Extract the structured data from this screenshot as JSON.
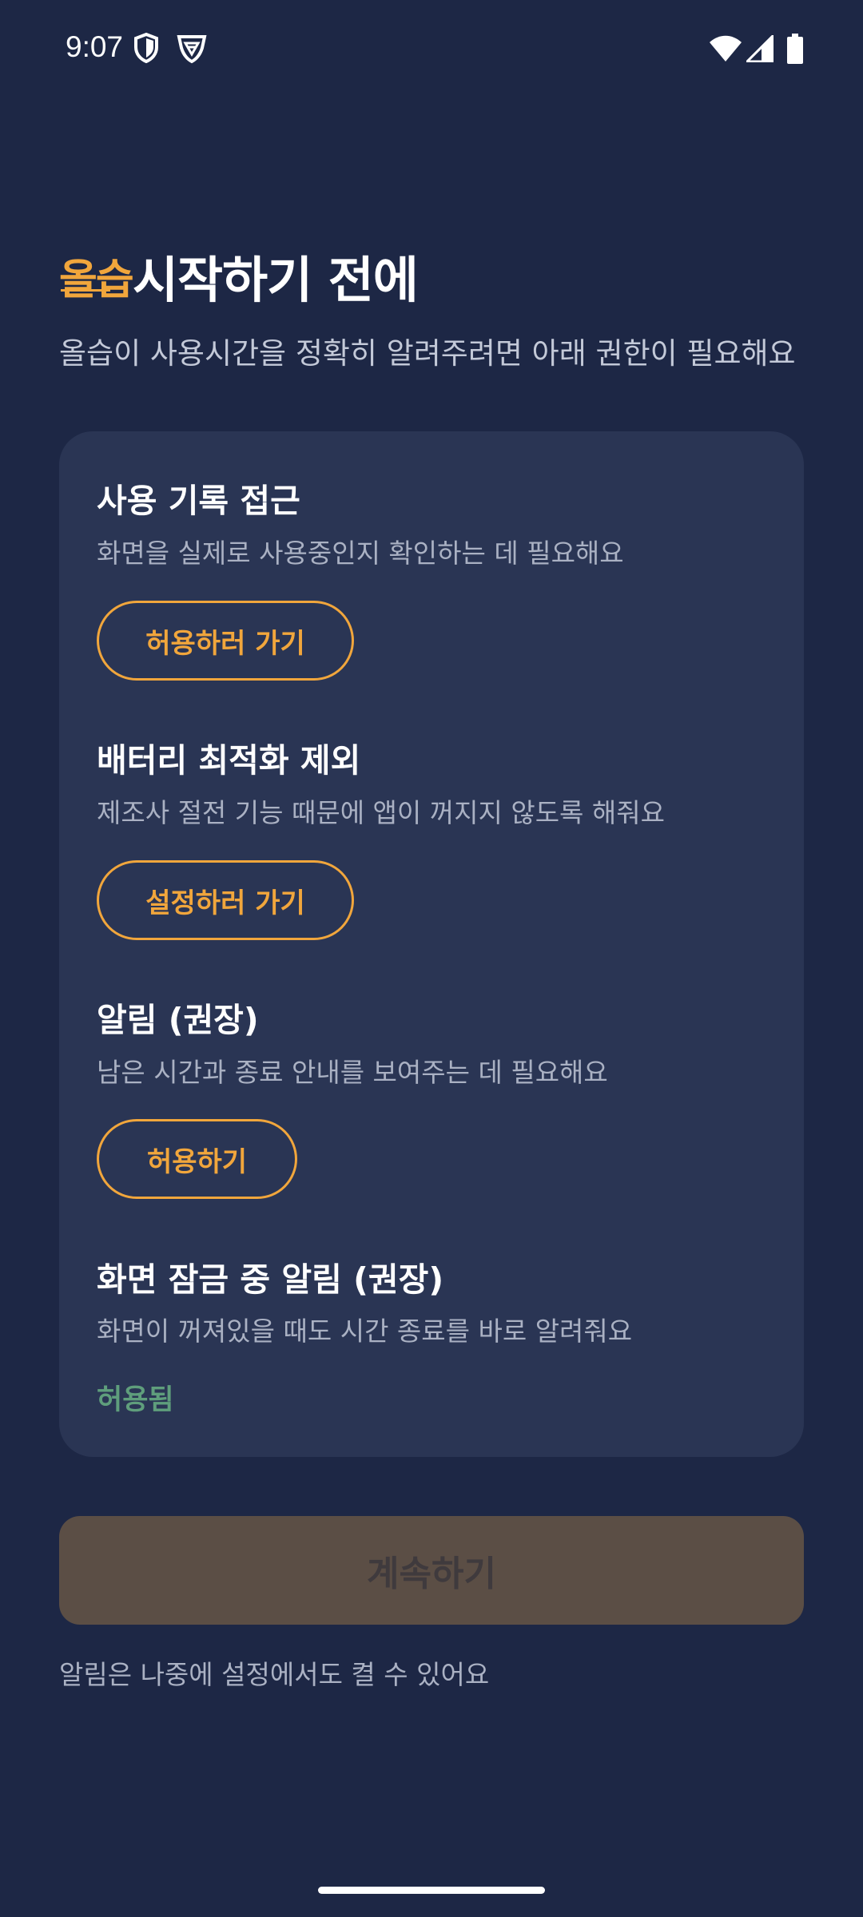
{
  "status_bar": {
    "time": "9:07",
    "icons": [
      "shield-icon",
      "vpn-shield-icon",
      "wifi-icon",
      "signal-icon",
      "battery-icon"
    ]
  },
  "header": {
    "logo_text": "올습",
    "title": "시작하기 전에",
    "subtitle": "올습이 사용시간을 정확히 알려주려면 아래 권한이 필요해요"
  },
  "permissions": [
    {
      "title": "사용 기록 접근",
      "description": "화면을 실제로 사용중인지 확인하는 데 필요해요",
      "action_label": "허용하러 가기"
    },
    {
      "title": "배터리 최적화 제외",
      "description": "제조사 절전 기능 때문에 앱이 꺼지지 않도록 해줘요",
      "action_label": "설정하러 가기"
    },
    {
      "title": "알림 (권장)",
      "description": "남은 시간과 종료 안내를 보여주는 데 필요해요",
      "action_label": "허용하기"
    },
    {
      "title": "화면 잠금 중 알림 (권장)",
      "description": "화면이 꺼져있을 때도 시간 종료를 바로 알려줘요",
      "status_label": "허용됨"
    }
  ],
  "continue_label": "계속하기",
  "footer_note": "알림은 나중에 설정에서도 켤 수 있어요",
  "colors": {
    "background": "#1d2745",
    "card": "#2a3554",
    "accent": "#f1a63c",
    "granted": "#5f9e7c",
    "continue_disabled": "#5b4e45"
  }
}
